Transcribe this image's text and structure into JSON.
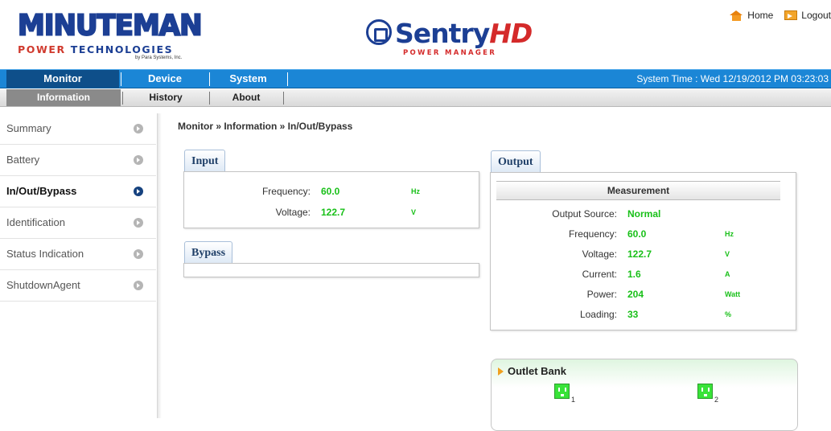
{
  "header": {
    "brand_main": "MINUTEMAN",
    "brand_sub": "POWER TECHNOLOGIES",
    "brand_tiny": "by Para Systems, Inc.",
    "product": "Sentry",
    "product_hd": "HD",
    "product_sub": "POWER MANAGER",
    "home_label": "Home",
    "logout_label": "Logout"
  },
  "nav": {
    "main": [
      "Monitor",
      "Device",
      "System"
    ],
    "system_time": "System Time : Wed 12/19/2012 PM 03:23:03",
    "sub": [
      "Information",
      "History",
      "About"
    ]
  },
  "sidebar": {
    "items": [
      {
        "label": "Summary"
      },
      {
        "label": "Battery"
      },
      {
        "label": "In/Out/Bypass"
      },
      {
        "label": "Identification"
      },
      {
        "label": "Status Indication"
      },
      {
        "label": "ShutdownAgent"
      }
    ],
    "active": "In/Out/Bypass"
  },
  "breadcrumb": "Monitor » Information » In/Out/Bypass",
  "input": {
    "tab": "Input",
    "frequency_label": "Frequency:",
    "frequency": "60.0",
    "frequency_unit": "Hz",
    "voltage_label": "Voltage:",
    "voltage": "122.7",
    "voltage_unit": "V"
  },
  "bypass": {
    "tab": "Bypass"
  },
  "output": {
    "tab": "Output",
    "measurement_header": "Measurement",
    "source_label": "Output Source:",
    "source": "Normal",
    "frequency_label": "Frequency:",
    "frequency": "60.0",
    "frequency_unit": "Hz",
    "voltage_label": "Voltage:",
    "voltage": "122.7",
    "voltage_unit": "V",
    "current_label": "Current:",
    "current": "1.6",
    "current_unit": "A",
    "power_label": "Power:",
    "power": "204",
    "power_unit": "Watt",
    "loading_label": "Loading:",
    "loading": "33",
    "loading_unit": "%"
  },
  "outlet_bank": {
    "title": "Outlet Bank",
    "outlets": [
      {
        "num": "1"
      },
      {
        "num": "2"
      }
    ]
  },
  "colors": {
    "nav_blue": "#1b86d6",
    "value_green": "#19c019",
    "outlet_on": "#39e339"
  }
}
